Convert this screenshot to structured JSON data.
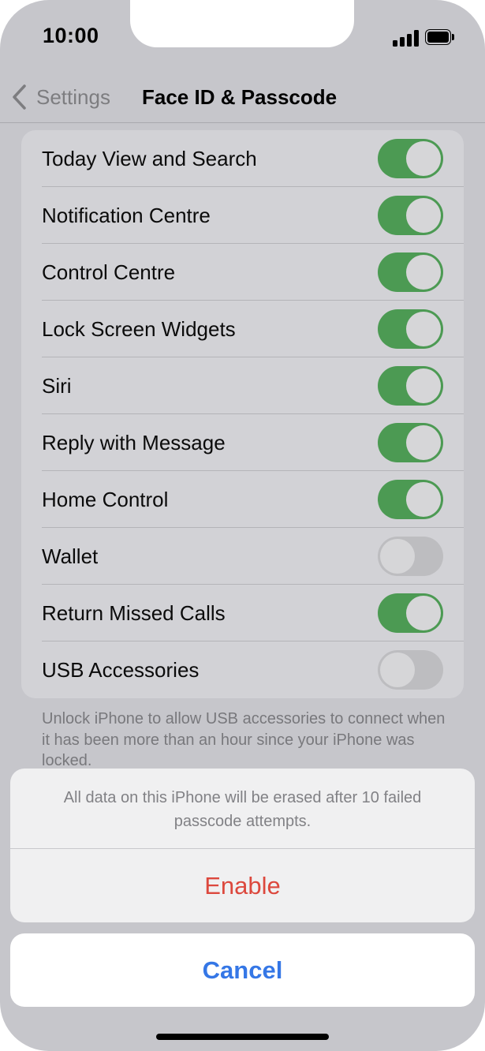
{
  "status_bar": {
    "time": "10:00",
    "signal_icon": "cellular-signal-icon",
    "battery_icon": "battery-icon"
  },
  "nav": {
    "back_label": "Settings",
    "back_icon": "chevron-left-icon",
    "title": "Face ID & Passcode"
  },
  "settings": [
    {
      "label": "Today View and Search",
      "on": true
    },
    {
      "label": "Notification Centre",
      "on": true
    },
    {
      "label": "Control Centre",
      "on": true
    },
    {
      "label": "Lock Screen Widgets",
      "on": true
    },
    {
      "label": "Siri",
      "on": true
    },
    {
      "label": "Reply with Message",
      "on": true
    },
    {
      "label": "Home Control",
      "on": true
    },
    {
      "label": "Wallet",
      "on": false
    },
    {
      "label": "Return Missed Calls",
      "on": true
    },
    {
      "label": "USB Accessories",
      "on": false
    }
  ],
  "footer_text": "Unlock iPhone to allow USB accessories to connect when it has been more than an hour since your iPhone was locked.",
  "action_sheet": {
    "message": "All data on this iPhone will be erased after 10 failed passcode attempts.",
    "enable_label": "Enable",
    "cancel_label": "Cancel"
  },
  "colors": {
    "toggle_on": "#4c9a53",
    "destructive": "#dc483d",
    "accent": "#3577e6"
  }
}
